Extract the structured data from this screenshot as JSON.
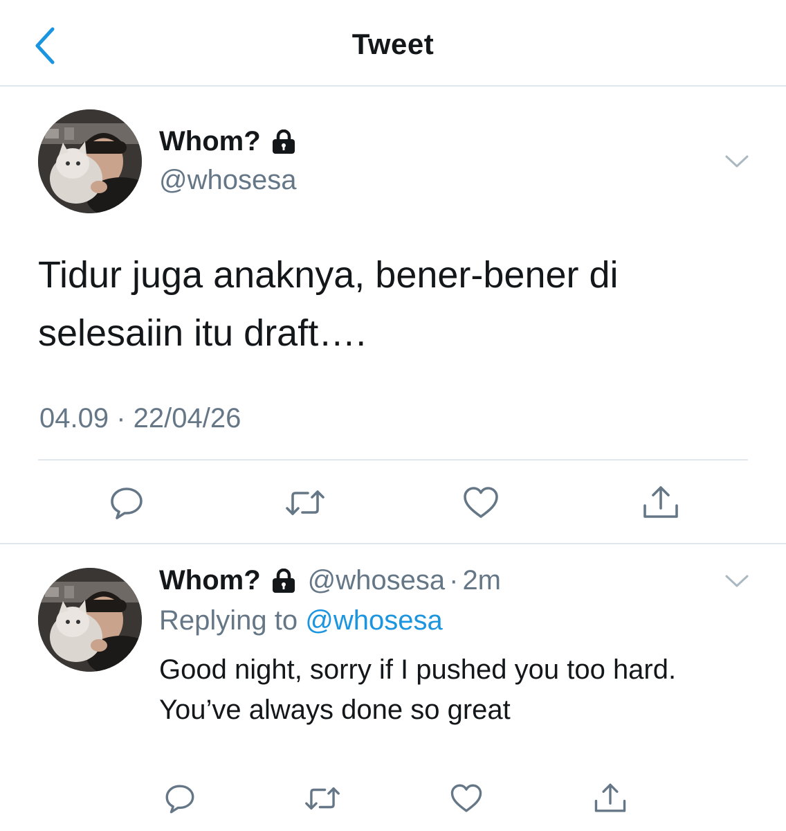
{
  "nav": {
    "title": "Tweet",
    "back_icon": "chevron-left-icon"
  },
  "colors": {
    "link_blue": "#1b95e0",
    "secondary_text": "#657786",
    "primary_text": "#14171a",
    "divider": "#e1e8ed"
  },
  "main_tweet": {
    "display_name": "Whom?",
    "handle": "@whosesa",
    "protected_icon": "lock-icon",
    "text_lines": [
      "Tidur juga anaknya, bener-bener di",
      "selesaiin itu draft…."
    ],
    "timestamp": "04.09 · 22/04/26",
    "actions": [
      "reply-icon",
      "retweet-icon",
      "like-icon",
      "share-icon"
    ]
  },
  "reply_tweet": {
    "display_name": "Whom?",
    "handle": "@whosesa",
    "dot": "·",
    "time": "2m",
    "replying_prefix": "Replying to",
    "replying_to": "@whosesa",
    "text_lines": [
      "Good night, sorry if I pushed you too hard.",
      "You’ve always done so great"
    ],
    "actions": [
      "reply-icon",
      "retweet-icon",
      "like-icon",
      "share-icon"
    ]
  }
}
